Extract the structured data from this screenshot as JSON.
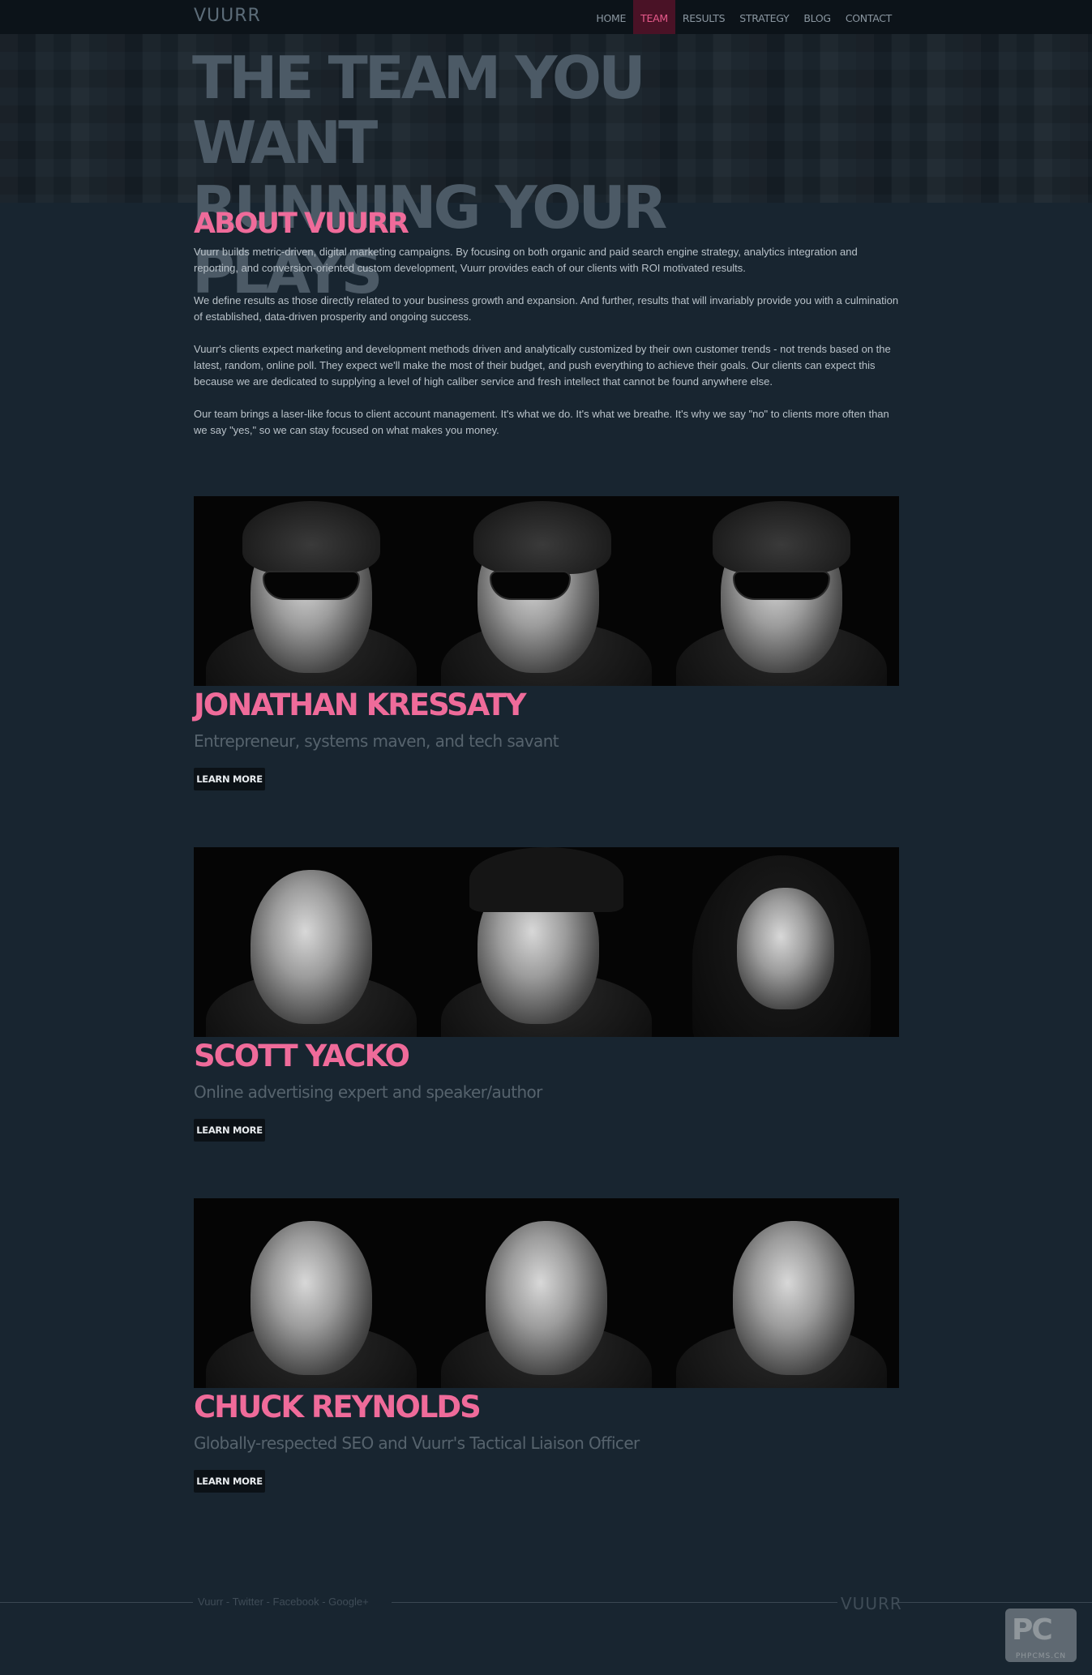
{
  "site": {
    "logo": "VUURR"
  },
  "nav": {
    "items": [
      {
        "label": "HOME",
        "active": false
      },
      {
        "label": "TEAM",
        "active": true
      },
      {
        "label": "RESULTS",
        "active": false
      },
      {
        "label": "STRATEGY",
        "active": false
      },
      {
        "label": "BLOG",
        "active": false
      },
      {
        "label": "CONTACT",
        "active": false
      }
    ]
  },
  "hero": {
    "line1": "THE TEAM YOU WANT",
    "line2": "RUNNING YOUR PLAYS"
  },
  "about": {
    "title": "ABOUT VUURR",
    "paragraphs": [
      "Vuurr builds metric-driven, digital marketing campaigns. By focusing on both organic and paid search engine strategy, analytics integration and reporting, and conversion-oriented custom development, Vuurr provides each of our clients with ROI motivated results.",
      "We define results as those directly related to your business growth and expansion. And further, results that will invariably provide you with a culmination of established, data-driven prosperity and ongoing success.",
      "Vuurr's clients expect marketing and development methods driven and analytically customized by their own customer trends - not trends based on the latest, random, online poll. They expect we'll make the most of their budget, and push everything to achieve their goals. Our clients can expect this because we are dedicated to supplying a level of high caliber service and fresh intellect that cannot be found anywhere else.",
      "Our team brings a laser-like focus to client account management. It's what we do. It's what we breathe. It's why we say \"no\" to clients more often than we say \"yes,\" so we can stay focused on what makes you money."
    ]
  },
  "team": [
    {
      "name": "JONATHAN KRESSATY",
      "role": "Entrepreneur, systems maven, and tech savant",
      "button": "LEARN MORE"
    },
    {
      "name": "SCOTT YACKO",
      "role": "Online advertising expert and speaker/author",
      "button": "LEARN MORE"
    },
    {
      "name": "CHUCK REYNOLDS",
      "role": "Globally-respected SEO and Vuurr's Tactical Liaison Officer",
      "button": "LEARN MORE"
    }
  ],
  "footer": {
    "links": [
      "Vuurr",
      "Twitter",
      "Facebook",
      "Google+"
    ],
    "separator": " - ",
    "logo": "VUURR"
  },
  "watermark": {
    "big": "PC",
    "small": "PHPCMS.CN"
  }
}
